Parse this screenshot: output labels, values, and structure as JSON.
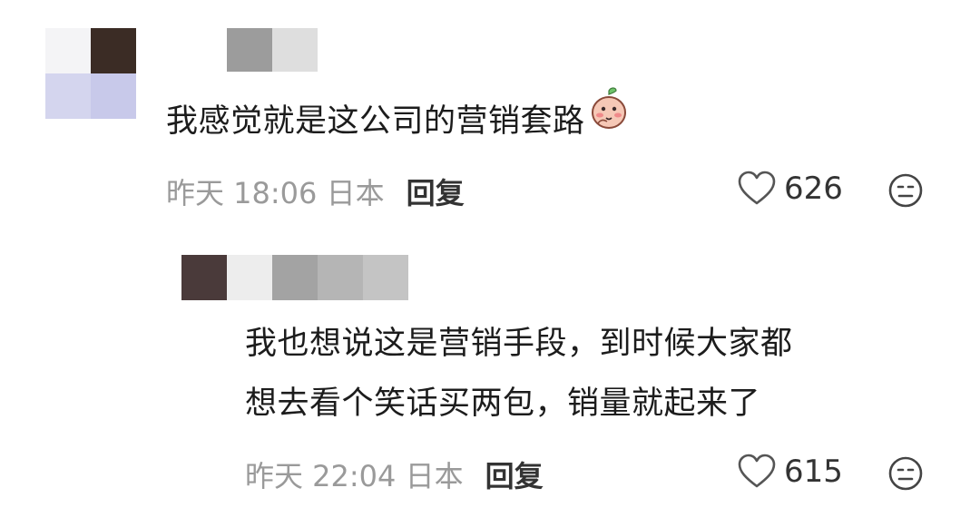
{
  "comments": [
    {
      "text": "我感觉就是这公司的营销套路",
      "emoji": "peach-face-emoji",
      "time": "昨天 18:06 日本",
      "reply_label": "回复",
      "likes": "626",
      "avatar_mosaic": [
        "#f4f4f6",
        "#3b2c25",
        "#d4d5ee",
        "#c8c9ea"
      ],
      "name_mosaic": [
        "#9c9c9c",
        "#dedede"
      ]
    },
    {
      "text_line1": "我也想说这是营销手段，到时候大家都",
      "text_line2": "想去看个笑话买两包，销量就起来了",
      "time": "昨天 22:04 日本",
      "reply_label": "回复",
      "likes": "615",
      "avatar_mosaic": [
        "#4a3a3a",
        "#ededed"
      ],
      "name_mosaic": [
        "#a3a3a3",
        "#b5b5b5",
        "#c4c4c4"
      ]
    }
  ],
  "icons": {
    "like": "heart-outline-icon",
    "dislike": "neutral-face-icon"
  },
  "colors": {
    "meta_text": "#9a9a9a",
    "body_text": "#1c1c1c"
  }
}
